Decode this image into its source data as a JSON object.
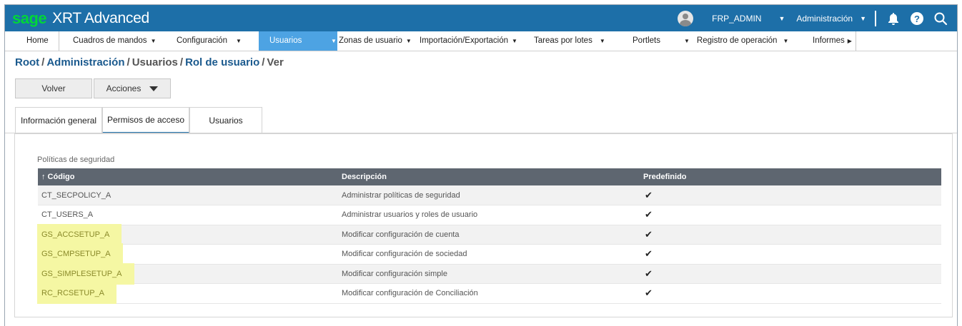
{
  "app": {
    "brand_sage": "sage",
    "brand_name": "XRT Advanced",
    "brand_color": "#00d639",
    "topbar_color": "#1d6fa8",
    "user": "FRP_ADMIN",
    "role_menu": "Administración",
    "icons": [
      "user-avatar-icon",
      "bell-icon",
      "help-icon",
      "search-icon"
    ]
  },
  "menu": {
    "home": "Home",
    "cuadros": "Cuadros de mandos",
    "configuracion": "Configuración",
    "usuarios": "Usuarios",
    "zonas": "Zonas de usuario",
    "importacion": "Importación/Exportación",
    "tareas": "Tareas por lotes",
    "portlets": "Portlets",
    "registro": "Registro de operación",
    "informes": "Informes"
  },
  "breadcrumb": {
    "root": "Root",
    "administracion": "Administración",
    "usuarios": "Usuarios",
    "rol": "Rol de usuario",
    "ver": "Ver"
  },
  "toolbar": {
    "volver": "Volver",
    "acciones": "Acciones"
  },
  "tabs": {
    "general": "Información general",
    "permisos": "Permisos de acceso",
    "usuarios": "Usuarios"
  },
  "section": {
    "title": "Políticas de seguridad"
  },
  "table": {
    "headers": {
      "codigo": "↑ Código",
      "descripcion": "Descripción",
      "predefinido": "Predefinido"
    },
    "rows": [
      {
        "codigo": "CT_SECPOLICY_A",
        "descripcion": "Administrar políticas de seguridad",
        "predefinido": "✔"
      },
      {
        "codigo": "CT_USERS_A",
        "descripcion": "Administrar usuarios y roles de usuario",
        "predefinido": "✔"
      },
      {
        "codigo": "GS_ACCSETUP_A",
        "descripcion": "Modificar configuración de cuenta",
        "predefinido": "✔"
      },
      {
        "codigo": "GS_CMPSETUP_A",
        "descripcion": "Modificar configuración de sociedad",
        "predefinido": "✔"
      },
      {
        "codigo": "GS_SIMPLESETUP_A",
        "descripcion": "Modificar configuración simple",
        "predefinido": "✔"
      },
      {
        "codigo": "RC_RCSETUP_A",
        "descripcion": "Modificar configuración de Conciliación",
        "predefinido": "✔"
      }
    ],
    "highlight_color": "#f5f7a3"
  }
}
